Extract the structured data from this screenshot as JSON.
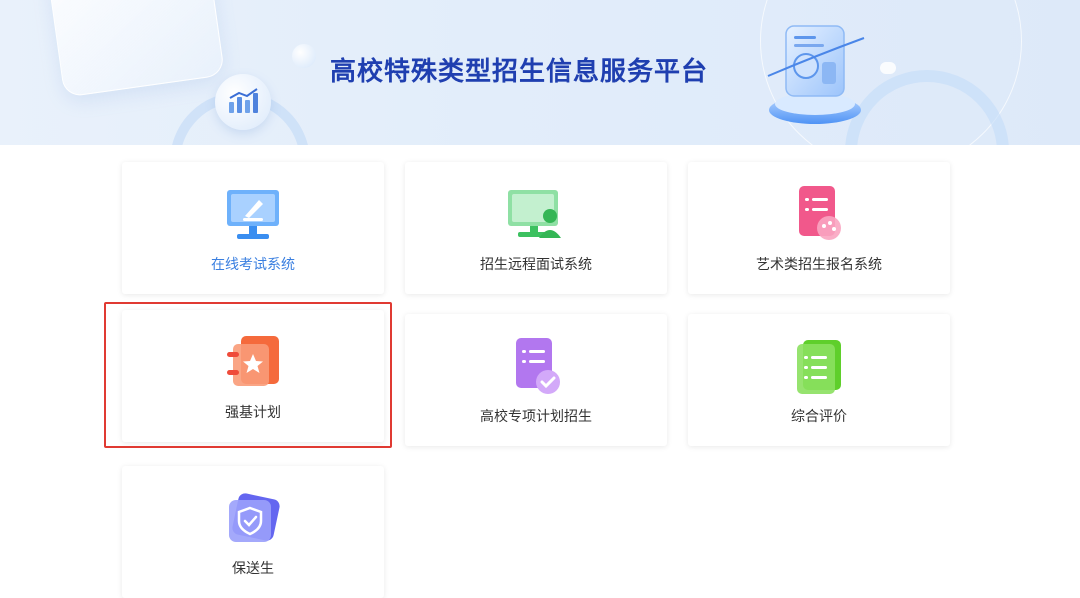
{
  "banner": {
    "title": "高校特殊类型招生信息服务平台"
  },
  "cards": [
    {
      "label": "在线考试系统",
      "icon": "online-exam-monitor-icon",
      "color": "#3a8ef0",
      "active": true
    },
    {
      "label": "招生远程面试系统",
      "icon": "remote-interview-screen-icon",
      "color": "#3cc160"
    },
    {
      "label": "艺术类招生报名系统",
      "icon": "art-registration-form-icon",
      "color": "#f1588b"
    },
    {
      "label": "强基计划",
      "icon": "star-notebook-icon",
      "color": "#f56a3c"
    },
    {
      "label": "高校专项计划招生",
      "icon": "checklist-document-icon",
      "color": "#a257e8"
    },
    {
      "label": "综合评价",
      "icon": "list-document-icon",
      "color": "#5fcf2b"
    },
    {
      "label": "保送生",
      "icon": "shield-check-icon",
      "color": "#6466f0"
    }
  ],
  "highlight_color": "#e03a32"
}
